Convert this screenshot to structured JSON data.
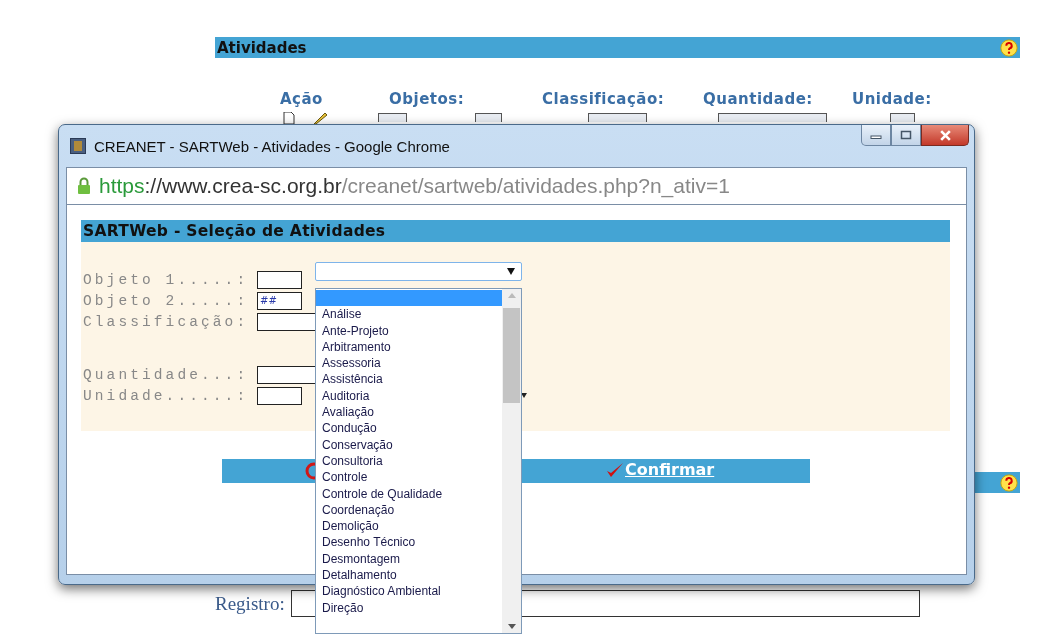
{
  "page": {
    "section_title": "Atividades",
    "columns": [
      "Ação",
      "Objetos:",
      "Classificação:",
      "Quantidade:",
      "Unidade:"
    ],
    "registro_label": "Registro:"
  },
  "popup": {
    "title": "CREANET - SARTWeb - Atividades - Google Chrome",
    "url_scheme": "https",
    "url_host": "://www.crea-sc.org.br",
    "url_path": "/creanet/sartweb/atividades.php?n_ativ=1",
    "heading": "SARTWeb - Seleção de Atividades",
    "fields": [
      {
        "label": "Objeto 1.....:",
        "kind": "select"
      },
      {
        "label": "Objeto 2.....:",
        "value": "##",
        "kind": "plain"
      },
      {
        "label": "Classificação:",
        "kind": "wide"
      },
      {
        "label": "Quantidade...:",
        "kind": "wide"
      },
      {
        "label": "Unidade......:",
        "kind": "caret"
      }
    ],
    "confirm": "Confirmar"
  },
  "dropdown": {
    "options": [
      {
        "selected": true
      },
      {
        "label": "Análise",
        "selected": false
      },
      {
        "label": "Ante-Projeto",
        "selected": false
      },
      {
        "label": "Arbitramento",
        "selected": false
      },
      {
        "label": "Assessoria",
        "selected": false
      },
      {
        "label": "Assistência",
        "selected": false
      },
      {
        "label": "Auditoria",
        "selected": false
      },
      {
        "label": "Avaliação",
        "selected": false
      },
      {
        "label": "Condução",
        "selected": false
      },
      {
        "label": "Conservação",
        "selected": false
      },
      {
        "label": "Consultoria",
        "selected": false
      },
      {
        "label": "Controle",
        "selected": false
      },
      {
        "label": "Controle de Qualidade",
        "selected": false
      },
      {
        "label": "Coordenação",
        "selected": false
      },
      {
        "label": "Demolição",
        "selected": false
      },
      {
        "label": "Desenho Técnico",
        "selected": false
      },
      {
        "label": "Desmontagem",
        "selected": false
      },
      {
        "label": "Detalhamento",
        "selected": false
      },
      {
        "label": "Diagnóstico Ambiental",
        "selected": false
      },
      {
        "label": "Direção",
        "selected": false
      }
    ]
  }
}
